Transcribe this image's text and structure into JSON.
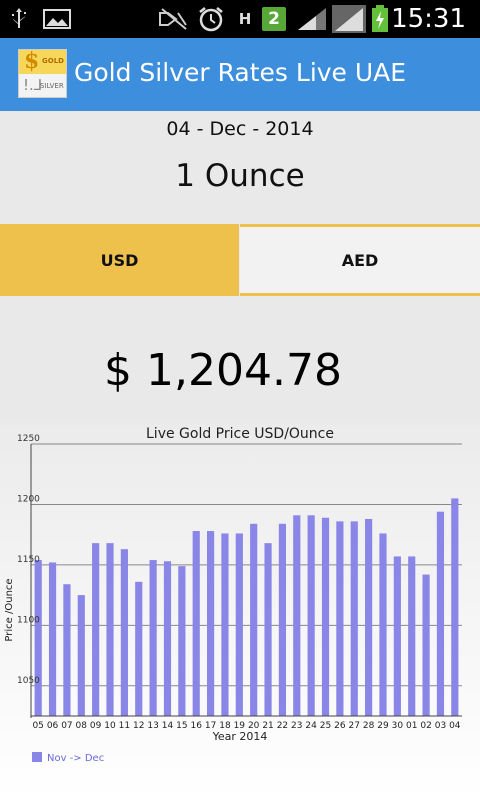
{
  "status_bar": {
    "time": "15:31",
    "icons": [
      "usb-icon",
      "image-icon",
      "signal-muted-icon",
      "alarm-icon",
      "h-network-icon",
      "notification-count-icon",
      "signal-icon",
      "signal-icon-2",
      "battery-charging-icon"
    ],
    "notification_count": "2",
    "network_type": "H"
  },
  "action_bar": {
    "title": "Gold Silver Rates Live UAE",
    "logo_gold_text": "GOLD",
    "logo_silver_text": "SILVER"
  },
  "header": {
    "date": "04 - Dec - 2014",
    "unit": "1 Ounce"
  },
  "tabs": [
    {
      "label": "USD",
      "selected": true
    },
    {
      "label": "AED",
      "selected": false
    }
  ],
  "price": "$ 1,204.78",
  "colors": {
    "accent": "#3d8edc",
    "tab_selected": "#eec14c",
    "bar": "#8a86e8"
  },
  "chart_data": {
    "type": "bar",
    "title": "Live Gold Price USD/Ounce",
    "xlabel": "Year 2014",
    "ylabel": "Price /Ounce",
    "ylim": [
      1025,
      1250
    ],
    "yticks": [
      1050,
      1100,
      1150,
      1200,
      1250
    ],
    "categories": [
      "05",
      "06",
      "07",
      "08",
      "09",
      "10",
      "11",
      "12",
      "13",
      "14",
      "15",
      "16",
      "17",
      "18",
      "19",
      "20",
      "21",
      "22",
      "23",
      "24",
      "25",
      "26",
      "27",
      "28",
      "29",
      "30",
      "01",
      "02",
      "03",
      "04"
    ],
    "series": [
      {
        "name": "Nov -> Dec",
        "values": [
          1154,
          1152,
          1134,
          1125,
          1168,
          1168,
          1163,
          1136,
          1154,
          1153,
          1149,
          1178,
          1178,
          1176,
          1176,
          1184,
          1168,
          1184,
          1191,
          1191,
          1189,
          1186,
          1186,
          1188,
          1176,
          1157,
          1157,
          1142,
          1194,
          1205
        ]
      }
    ],
    "legend": "bottom-left",
    "grid": true
  }
}
